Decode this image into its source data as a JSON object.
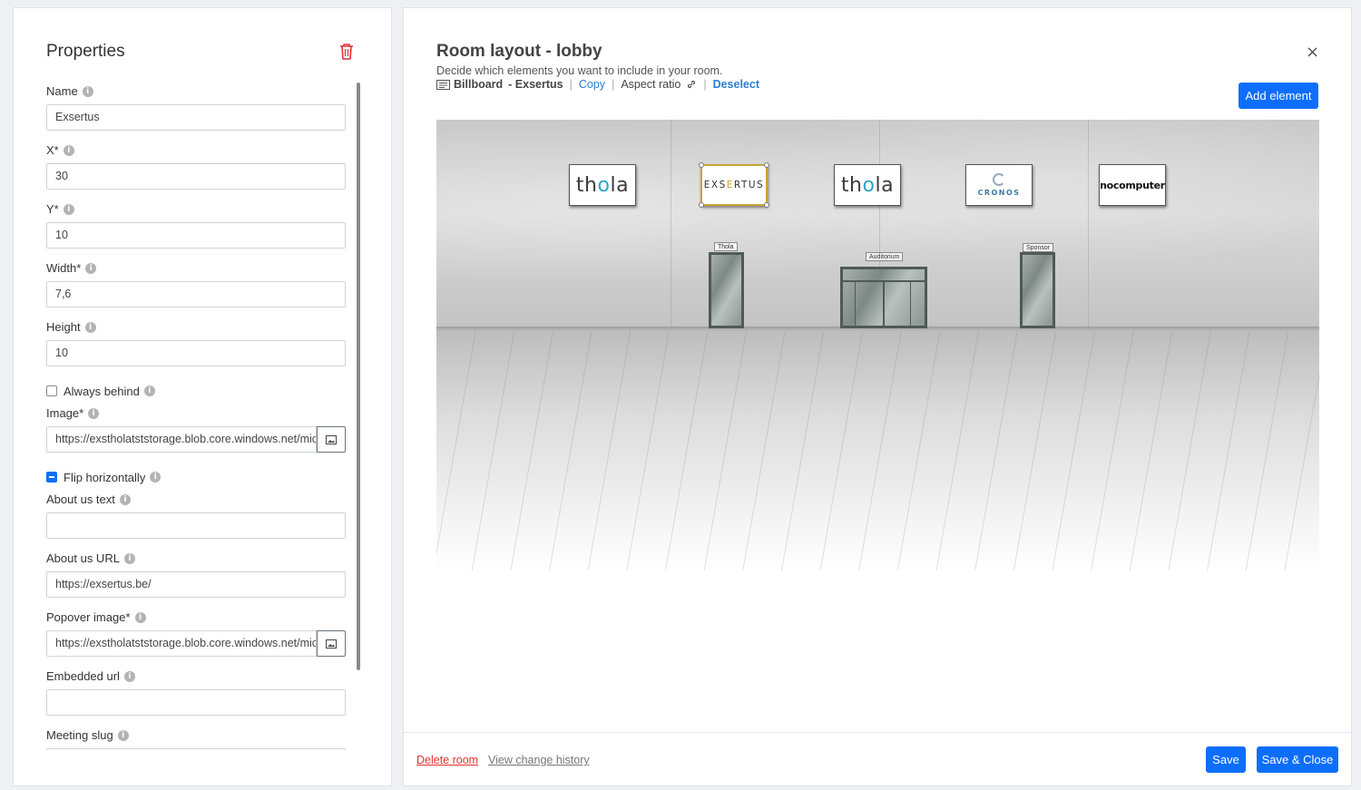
{
  "properties": {
    "title": "Properties",
    "fields": [
      {
        "label": "Name",
        "value": "Exsertus"
      },
      {
        "label": "X*",
        "value": "30"
      },
      {
        "label": "Y*",
        "value": "10"
      },
      {
        "label": "Width*",
        "value": "7,6"
      },
      {
        "label": "Height",
        "value": "10"
      }
    ],
    "always_behind": {
      "label": "Always behind",
      "checked": false
    },
    "image": {
      "label": "Image*",
      "value": "https://exstholatststorage.blob.core.windows.net/mic"
    },
    "flip_horizontally": {
      "label": "Flip horizontally",
      "checked": true
    },
    "about_text": {
      "label": "About us text",
      "value": ""
    },
    "about_url": {
      "label": "About us URL",
      "value": "https://exsertus.be/"
    },
    "popover_image": {
      "label": "Popover image*",
      "value": "https://exstholatststorage.blob.core.windows.net/mic"
    },
    "embedded_url": {
      "label": "Embedded url",
      "value": ""
    },
    "meeting_slug": {
      "label": "Meeting slug",
      "value": ""
    }
  },
  "room": {
    "title": "Room layout - lobby",
    "subtitle": "Decide which elements you want to include in your room.",
    "toolbar": {
      "element_type": "Billboard",
      "element_name": "- Exsertus",
      "copy": "Copy",
      "aspect_ratio": "Aspect ratio",
      "deselect": "Deselect"
    },
    "add_element": "Add element",
    "close": "×",
    "billboards": [
      "thola",
      "EXSERTUS",
      "thola",
      "CRONOS",
      "nocomputer"
    ],
    "door_signs": [
      "Thola",
      "Auditorium",
      "Sponsor"
    ]
  },
  "footer": {
    "delete_room": "Delete room",
    "view_history": "View change history",
    "save": "Save",
    "save_close": "Save & Close"
  },
  "colors": {
    "primary": "#0d6efd",
    "danger": "#e03131",
    "link": "#2a7fd8"
  }
}
